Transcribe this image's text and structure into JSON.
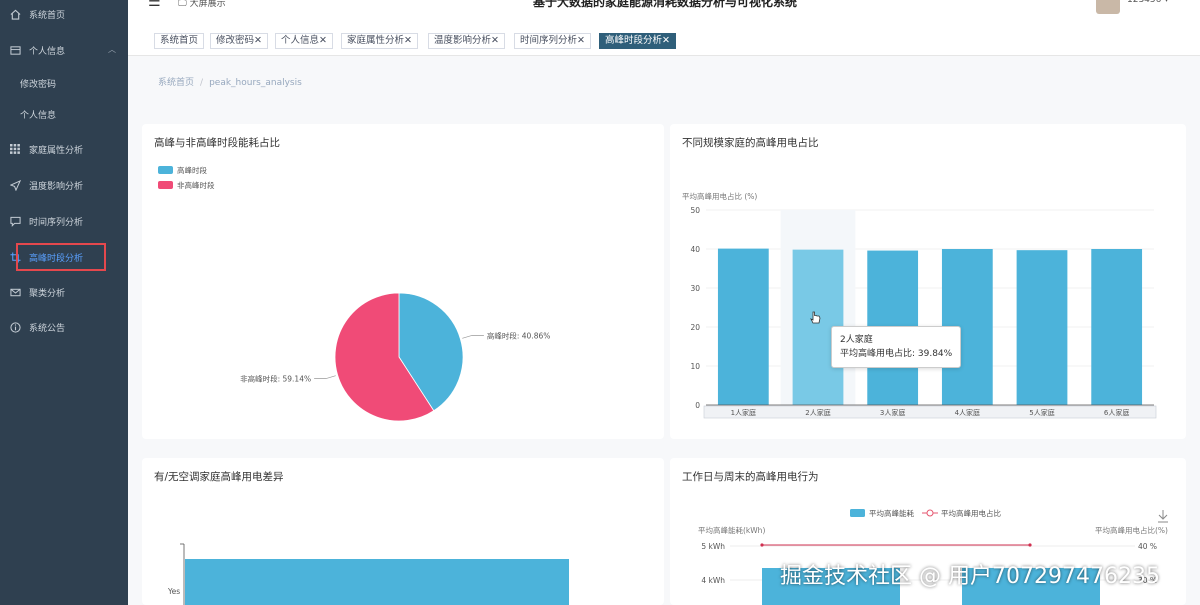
{
  "header": {
    "title": "基于大数据的家庭能源消耗数据分析与可视化系统",
    "fullscreen_label": "大屏展示",
    "username": "123456"
  },
  "sidebar": {
    "items": [
      {
        "label": "系统首页",
        "icon": "home-icon"
      },
      {
        "label": "个人信息",
        "icon": "user-icon"
      },
      {
        "label": "修改密码",
        "icon": ""
      },
      {
        "label": "个人信息",
        "icon": ""
      },
      {
        "label": "家庭属性分析",
        "icon": "grid-icon"
      },
      {
        "label": "温度影响分析",
        "icon": "send-icon"
      },
      {
        "label": "时间序列分析",
        "icon": "chat-icon"
      },
      {
        "label": "高峰时段分析",
        "icon": "crop-icon"
      },
      {
        "label": "聚类分析",
        "icon": "mail-icon"
      },
      {
        "label": "系统公告",
        "icon": "info-icon"
      }
    ]
  },
  "tags": [
    {
      "label": "系统首页"
    },
    {
      "label": "修改密码",
      "close": "✕"
    },
    {
      "label": "个人信息",
      "close": "✕"
    },
    {
      "label": "家庭属性分析",
      "close": "✕"
    },
    {
      "label": "温度影响分析",
      "close": "✕"
    },
    {
      "label": "时间序列分析",
      "close": "✕"
    },
    {
      "label": "高峰时段分析",
      "close": "✕"
    }
  ],
  "breadcrumb": {
    "home": "系统首页",
    "sep": "/",
    "current": "peak_hours_analysis"
  },
  "colors": {
    "accent": "#2f5f7a",
    "sidebar": "#2f4050",
    "blue": "#4cb3da",
    "pink": "#f04b77",
    "highlight": "#e5484d"
  },
  "cards": {
    "pie_title": "高峰与非高峰时段能耗占比",
    "bar_title": "不同规模家庭的高峰用电占比",
    "ac_title": "有/无空调家庭高峰用电差异",
    "weekday_title": "工作日与周末的高峰用电行为"
  },
  "chart_data": [
    {
      "type": "pie",
      "title": "高峰与非高峰时段能耗占比",
      "slices": [
        {
          "name": "高峰时段",
          "value": 40.86,
          "color": "#4cb3da"
        },
        {
          "name": "非高峰时段",
          "value": 59.14,
          "color": "#f04b77"
        }
      ],
      "legend": [
        "高峰时段",
        "非高峰时段"
      ],
      "labels": [
        "高峰时段: 40.86%",
        "非高峰时段: 59.14%"
      ]
    },
    {
      "type": "bar",
      "title": "不同规模家庭的高峰用电占比",
      "ylabel": "平均高峰用电占比 (%)",
      "categories": [
        "1人家庭",
        "2人家庭",
        "3人家庭",
        "4人家庭",
        "5人家庭",
        "6人家庭"
      ],
      "values": [
        40.1,
        39.84,
        39.6,
        40.0,
        39.7,
        40.0
      ],
      "ylim": [
        0,
        50
      ],
      "yticks": [
        "0",
        "10",
        "20",
        "30",
        "40",
        "50"
      ],
      "tooltip": {
        "title": "2人家庭",
        "line": "平均高峰用电占比: 39.84%"
      }
    },
    {
      "type": "bar",
      "title": "有/无空调家庭高峰用电差异",
      "categories": [
        "Yes"
      ],
      "orientation": "horizontal"
    },
    {
      "type": "bar",
      "title": "工作日与周末的高峰用电行为",
      "legend": [
        "平均高峰能耗",
        "平均高峰用电占比"
      ],
      "ylabel_left": "平均高峰能耗(kWh)",
      "ylabel_right": "平均高峰用电占比(%)",
      "yticks_left": [
        "4 kWh",
        "5 kWh"
      ],
      "yticks_right": [
        "30 %",
        "40 %"
      ]
    }
  ],
  "watermark": "掘金技术社区 @ 用户707297476235"
}
